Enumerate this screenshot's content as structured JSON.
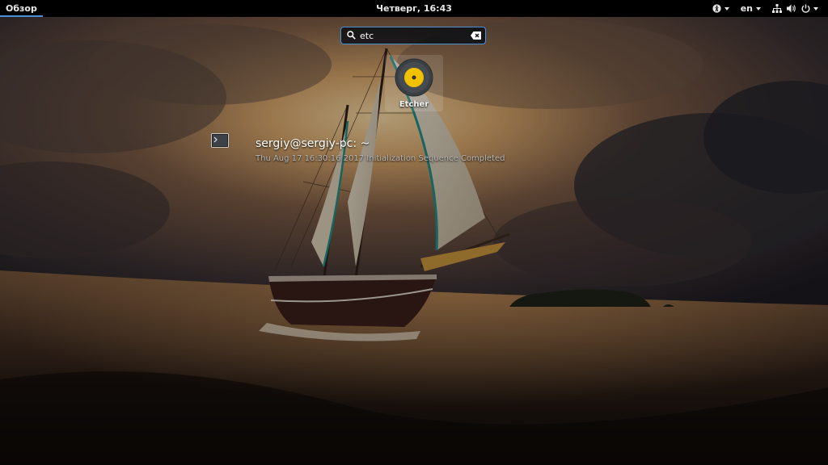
{
  "topbar": {
    "activities_label": "Обзор",
    "clock": "Четверг, 16:43",
    "language": "en"
  },
  "search": {
    "query": "etc"
  },
  "app_results": [
    {
      "name": "Etcher",
      "icon": "etcher-icon"
    }
  ],
  "terminal_result": {
    "title": "sergiy@sergiy-pc: ~",
    "description": "Thu Aug 17 16:30:16 2017 Initialization Sequence Completed",
    "icon": "terminal-icon"
  },
  "colors": {
    "accent": "#4a90d9",
    "etcher_yellow": "#f2c100",
    "topbar": "#000000"
  }
}
